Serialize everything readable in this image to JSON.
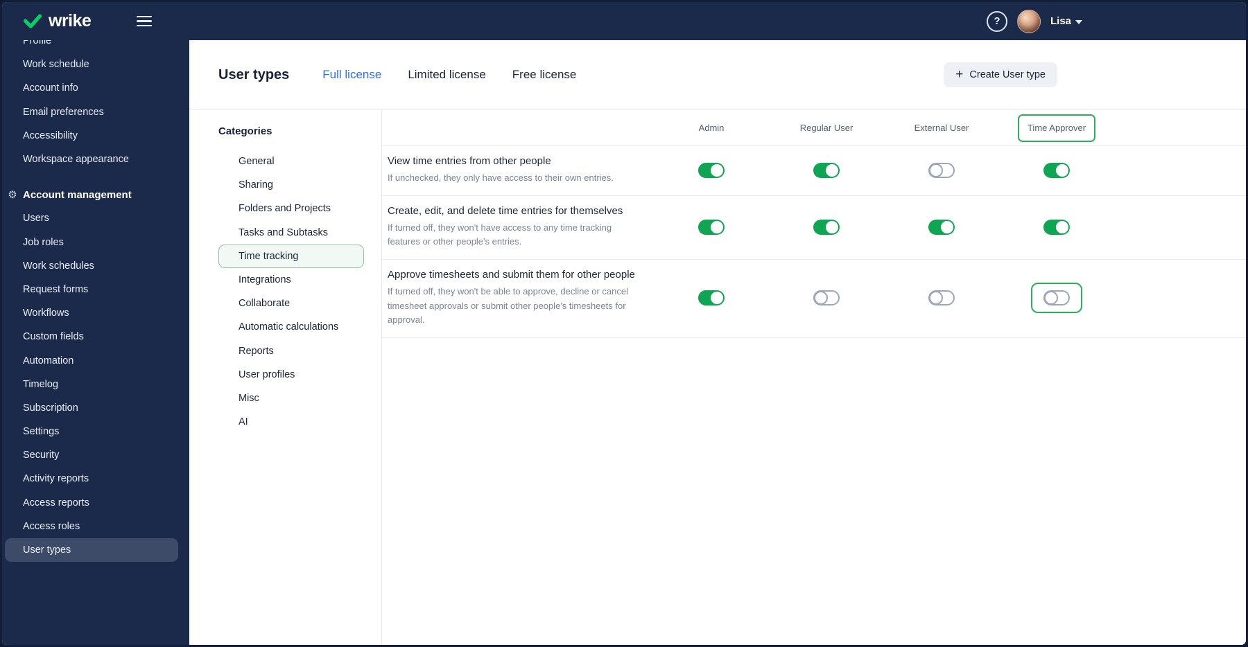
{
  "topbar": {
    "brand": "wrike",
    "help_label": "?",
    "user_name": "Lisa"
  },
  "sidebar": {
    "top_items": [
      "Profile",
      "Work schedule",
      "Account info",
      "Email preferences",
      "Accessibility",
      "Workspace appearance"
    ],
    "section_label": "Account management",
    "section_icon": "⚙",
    "section_items": [
      "Users",
      "Job roles",
      "Work schedules",
      "Request forms",
      "Workflows",
      "Custom fields",
      "Automation",
      "Timelog",
      "Subscription",
      "Settings",
      "Security",
      "Activity reports",
      "Access reports",
      "Access roles",
      "User types"
    ],
    "selected_item": "User types"
  },
  "main": {
    "page_title": "User types",
    "tabs": [
      {
        "label": "Full license",
        "active": true
      },
      {
        "label": "Limited license",
        "active": false
      },
      {
        "label": "Free license",
        "active": false
      }
    ],
    "create_button_icon": "+",
    "create_button_label": "Create User type",
    "categories": {
      "heading": "Categories",
      "items": [
        "General",
        "Sharing",
        "Folders and Projects",
        "Tasks and Subtasks",
        "Time tracking",
        "Integrations",
        "Collaborate",
        "Automatic calculations",
        "Reports",
        "User profiles",
        "Misc",
        "AI"
      ],
      "selected_item": "Time tracking"
    },
    "permissions_table": {
      "columns": [
        "Admin",
        "Regular User",
        "External User",
        "Time Approver"
      ],
      "highlighted_column": "Time Approver",
      "rows": [
        {
          "title": "View time entries from other people",
          "description": "If unchecked, they only have access to their own entries.",
          "toggles": [
            true,
            true,
            false,
            true
          ],
          "highlighted_toggle": null
        },
        {
          "title": "Create, edit, and delete time entries for themselves",
          "description": "If turned off, they won't have access to any time tracking features or other people's entries.",
          "toggles": [
            true,
            true,
            true,
            true
          ],
          "highlighted_toggle": null
        },
        {
          "title": "Approve timesheets and submit them for other people",
          "description": "If turned off, they won't be able to approve, decline or cancel timesheet approvals or submit other people's timesheets for approval.",
          "toggles": [
            true,
            false,
            false,
            false
          ],
          "highlighted_toggle": 3
        }
      ]
    }
  },
  "colors": {
    "navy": "#1b2a4a",
    "toggle_green": "#0fa653",
    "highlight_green": "#2bb05a",
    "active_tab_blue": "#2e6ef2"
  }
}
